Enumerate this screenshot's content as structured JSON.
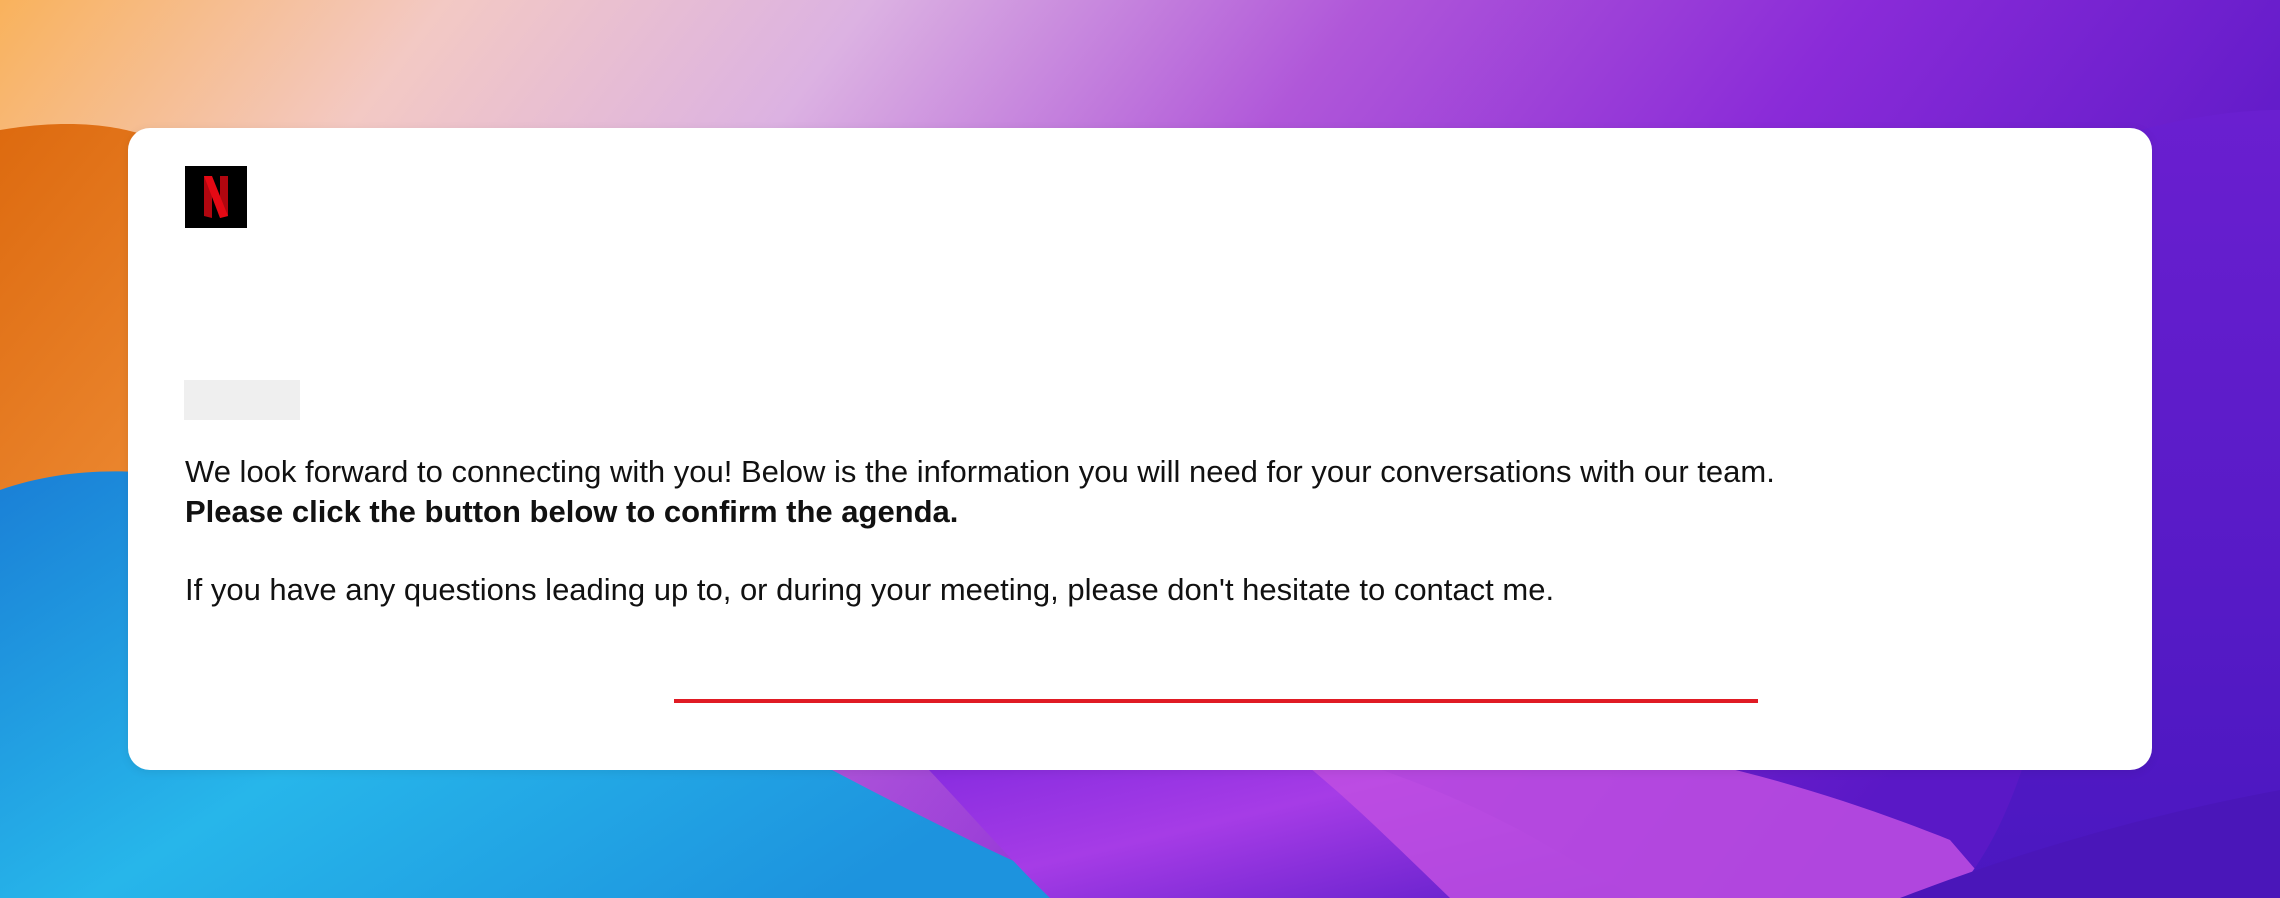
{
  "wallpaper": {
    "colors": [
      "#f7a64a",
      "#e06c10",
      "#d9b9e8",
      "#a44ed8",
      "#7a22d9",
      "#5b1bc4",
      "#27a9e6",
      "#1b8fd8",
      "#b340e0",
      "#4a1fbf"
    ]
  },
  "email": {
    "logo": {
      "icon": "netflix-logo-icon",
      "letter": "N",
      "background": "#000000",
      "color": "#e50914"
    },
    "body": {
      "intro": "We look forward to connecting with you! Below is the information you will need for your conversations with our team.",
      "instruction": "Please click the button below to confirm the agenda.",
      "contact": "If you have any questions leading up to, or during your meeting, please don't hesitate to contact me."
    },
    "cta": {
      "accent": "#e01b24"
    }
  }
}
